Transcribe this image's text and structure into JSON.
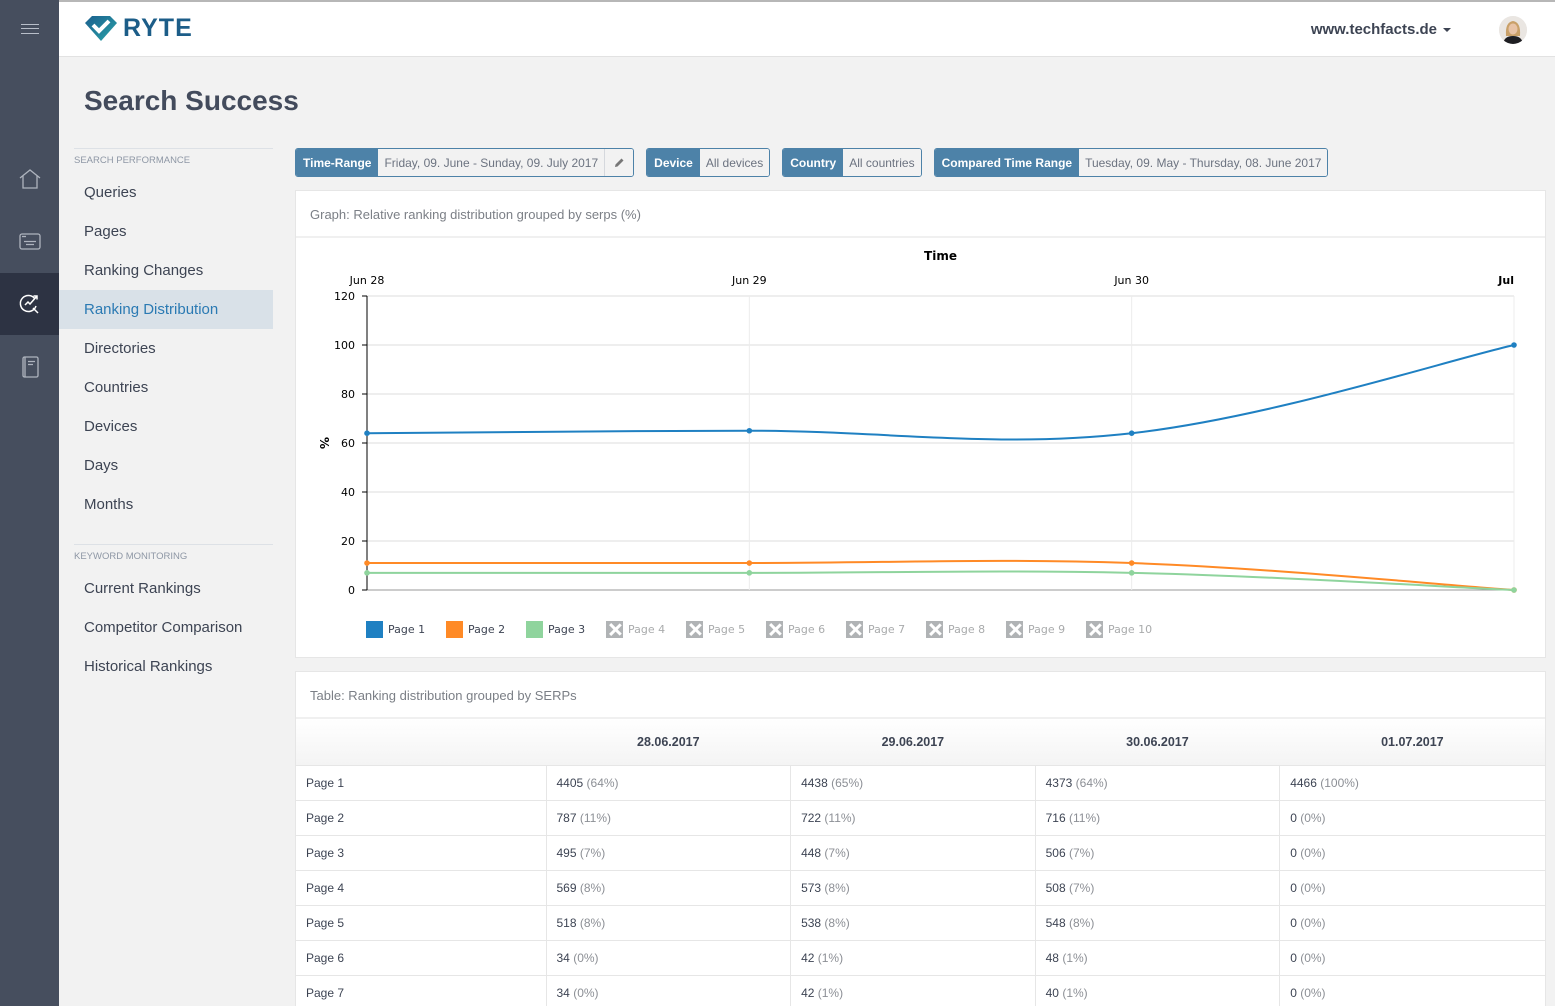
{
  "app": {
    "brand": "RYTE",
    "site": "www.techfacts.de"
  },
  "rail": {
    "items": [
      {
        "icon": "home-icon"
      },
      {
        "icon": "browser-window-icon"
      },
      {
        "icon": "search-success-icon",
        "active": true
      },
      {
        "icon": "notebook-icon"
      }
    ]
  },
  "page": {
    "title": "Search Success"
  },
  "subnav": {
    "sections": [
      {
        "heading": "Search Performance",
        "items": [
          "Queries",
          "Pages",
          "Ranking Changes",
          "Ranking Distribution",
          "Directories",
          "Countries",
          "Devices",
          "Days",
          "Months"
        ]
      },
      {
        "heading": "Keyword Monitoring",
        "items": [
          "Current Rankings",
          "Competitor Comparison",
          "Historical Rankings"
        ]
      }
    ],
    "active": "Ranking Distribution"
  },
  "filters": {
    "time_range": {
      "label": "Time-Range",
      "value": "Friday, 09. June - Sunday, 09. July 2017"
    },
    "device": {
      "label": "Device",
      "value": "All devices"
    },
    "country": {
      "label": "Country",
      "value": "All countries"
    },
    "compared": {
      "label": "Compared Time Range",
      "value": "Tuesday, 09. May - Thursday, 08. June 2017"
    }
  },
  "graph_card": {
    "title": "Graph: Relative ranking distribution grouped by serps (%)"
  },
  "chart_data": {
    "type": "line",
    "title": "Time",
    "xlabel": "Time",
    "ylabel": "%",
    "x": [
      "Jun 28",
      "Jun 29",
      "Jun 30",
      "Jul"
    ],
    "ylim": [
      0,
      120
    ],
    "yticks": [
      0,
      20,
      40,
      60,
      80,
      100,
      120
    ],
    "grid": true,
    "legend_position": "bottom-left",
    "series": [
      {
        "name": "Page 1",
        "color": "#1f80c2",
        "visible": true,
        "values": [
          64,
          65,
          64,
          100
        ]
      },
      {
        "name": "Page 2",
        "color": "#ff8a26",
        "visible": true,
        "values": [
          11,
          11,
          11,
          0
        ]
      },
      {
        "name": "Page 3",
        "color": "#8fd49d",
        "visible": true,
        "values": [
          7,
          7,
          7,
          0
        ]
      },
      {
        "name": "Page 4",
        "visible": false
      },
      {
        "name": "Page 5",
        "visible": false
      },
      {
        "name": "Page 6",
        "visible": false
      },
      {
        "name": "Page 7",
        "visible": false
      },
      {
        "name": "Page 8",
        "visible": false
      },
      {
        "name": "Page 9",
        "visible": false
      },
      {
        "name": "Page 10",
        "visible": false
      }
    ]
  },
  "table_card": {
    "title": "Table: Ranking distribution grouped by SERPs",
    "columns": [
      "",
      "28.06.2017",
      "29.06.2017",
      "30.06.2017",
      "01.07.2017"
    ],
    "rows": [
      {
        "label": "Page 1",
        "cells": [
          [
            "4405",
            "(64%)"
          ],
          [
            "4438",
            "(65%)"
          ],
          [
            "4373",
            "(64%)"
          ],
          [
            "4466",
            "(100%)"
          ]
        ]
      },
      {
        "label": "Page 2",
        "cells": [
          [
            "787",
            "(11%)"
          ],
          [
            "722",
            "(11%)"
          ],
          [
            "716",
            "(11%)"
          ],
          [
            "0",
            "(0%)"
          ]
        ]
      },
      {
        "label": "Page 3",
        "cells": [
          [
            "495",
            "(7%)"
          ],
          [
            "448",
            "(7%)"
          ],
          [
            "506",
            "(7%)"
          ],
          [
            "0",
            "(0%)"
          ]
        ]
      },
      {
        "label": "Page 4",
        "cells": [
          [
            "569",
            "(8%)"
          ],
          [
            "573",
            "(8%)"
          ],
          [
            "508",
            "(7%)"
          ],
          [
            "0",
            "(0%)"
          ]
        ]
      },
      {
        "label": "Page 5",
        "cells": [
          [
            "518",
            "(8%)"
          ],
          [
            "538",
            "(8%)"
          ],
          [
            "548",
            "(8%)"
          ],
          [
            "0",
            "(0%)"
          ]
        ]
      },
      {
        "label": "Page 6",
        "cells": [
          [
            "34",
            "(0%)"
          ],
          [
            "42",
            "(1%)"
          ],
          [
            "48",
            "(1%)"
          ],
          [
            "0",
            "(0%)"
          ]
        ]
      },
      {
        "label": "Page 7",
        "cells": [
          [
            "34",
            "(0%)"
          ],
          [
            "42",
            "(1%)"
          ],
          [
            "40",
            "(1%)"
          ],
          [
            "0",
            "(0%)"
          ]
        ]
      }
    ]
  }
}
